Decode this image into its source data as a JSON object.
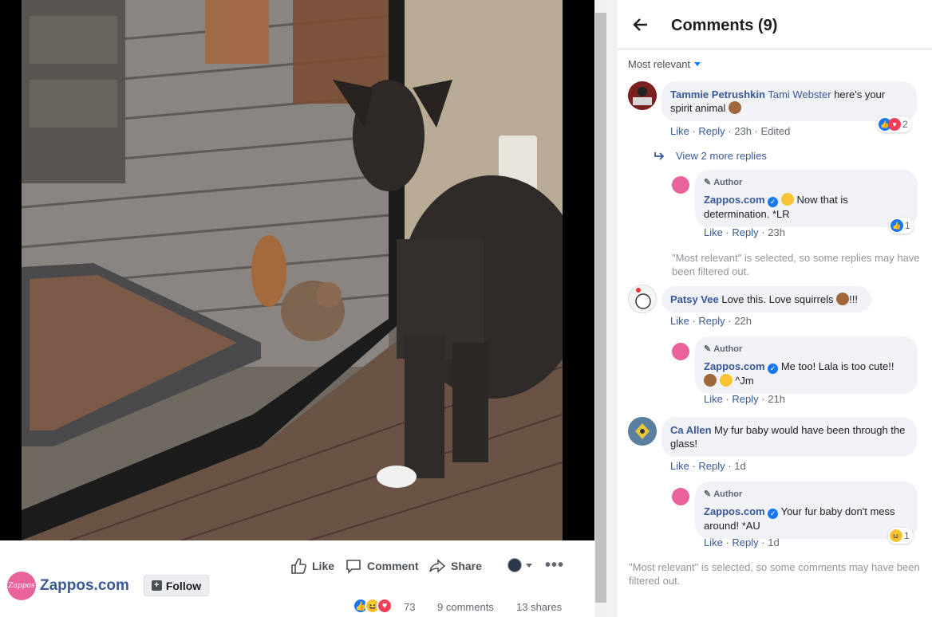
{
  "page": {
    "name": "Zappos.com",
    "avatar_text": "Zappos",
    "follow_label": "Follow"
  },
  "actions": {
    "like": "Like",
    "comment": "Comment",
    "share": "Share",
    "more": "•••"
  },
  "stats": {
    "reaction_count": "73",
    "comments": "9 comments",
    "shares": "13 shares"
  },
  "panel": {
    "title": "Comments (9)",
    "sort_label": "Most relevant",
    "view_more_replies": "View 2 more replies",
    "filtered_note_replies": "\"Most relevant\" is selected, so some replies may have been filtered out.",
    "filtered_note_comments": "\"Most relevant\" is selected, so some comments may have been filtered out."
  },
  "comments": [
    {
      "author": "Tammie Petrushkin",
      "mention": "Tami Webster",
      "text": " here's your spirit animal",
      "like": "Like",
      "reply": "Reply",
      "meta": "23h · Edited",
      "reactions": "2",
      "reply_item": {
        "tag": "Author",
        "author": "Zappos.com",
        "text": "Now that is determination. *LR",
        "like": "Like",
        "reply": "Reply",
        "meta": "23h",
        "reactions": "1"
      }
    },
    {
      "author": "Patsy Vee",
      "text": "Love this. Love squirrels",
      "suffix": "!!!",
      "like": "Like",
      "reply": "Reply",
      "meta": "22h",
      "reply_item": {
        "tag": "Author",
        "author": "Zappos.com",
        "text": "Me too! Lala is too cute!!",
        "suffix": "^Jm",
        "like": "Like",
        "reply": "Reply",
        "meta": "21h"
      }
    },
    {
      "author": "Ca Allen",
      "text": "My fur baby would have been through the glass!",
      "like": "Like",
      "reply": "Reply",
      "meta": "1d",
      "reply_item": {
        "tag": "Author",
        "author": "Zappos.com",
        "text": "Your fur baby don't mess around! *AU",
        "like": "Like",
        "reply": "Reply",
        "meta": "1d",
        "reactions": "1"
      }
    }
  ],
  "colors": {
    "link_blue": "#385898",
    "fb_blue": "#1877f2",
    "bubble_bg": "#f0f2f5",
    "zappos_pink": "#e9639a"
  }
}
